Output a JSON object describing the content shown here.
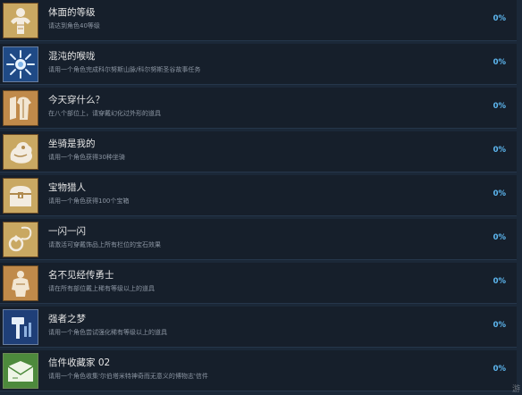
{
  "achievements": [
    {
      "title": "体面的等级",
      "desc": "请达到角色40等级",
      "percent": "0%",
      "icon": "muscle-figure-icon",
      "icon_bg": "#c9a862"
    },
    {
      "title": "混沌的喉咙",
      "desc": "请用一个角色完成科尔努斯山脉/科尔努斯圣谷故事任务",
      "percent": "0%",
      "icon": "chaos-burst-icon",
      "icon_bg": "#1f4a86"
    },
    {
      "title": "今天穿什么？",
      "desc": "在八个部位上，请穿戴幻化过外形的道具",
      "percent": "0%",
      "icon": "wardrobe-icon",
      "icon_bg": "#c08a4a"
    },
    {
      "title": "坐骑是我的",
      "desc": "请用一个角色获得30种坐骑",
      "percent": "0%",
      "icon": "mount-icon",
      "icon_bg": "#c9a862"
    },
    {
      "title": "宝物猎人",
      "desc": "请用一个角色获得100个宝箱",
      "percent": "0%",
      "icon": "treasure-chest-icon",
      "icon_bg": "#c9a862"
    },
    {
      "title": "一闪一闪",
      "desc": "请激活可穿戴饰品上所有栏位的宝石效果",
      "percent": "0%",
      "icon": "gem-ring-icon",
      "icon_bg": "#c9a862"
    },
    {
      "title": "名不见经传勇士",
      "desc": "请在所有部位戴上稀有等级以上的道具",
      "percent": "0%",
      "icon": "warrior-icon",
      "icon_bg": "#c08a4a"
    },
    {
      "title": "强者之梦",
      "desc": "请用一个角色尝试强化稀有等级以上的道具",
      "percent": "0%",
      "icon": "hammer-icon",
      "icon_bg": "#1f3f78"
    },
    {
      "title": "信件收藏家 02",
      "desc": "请用一个角色收集'尔伯塔米特神奇而无意义的博物志'信件",
      "percent": "0%",
      "icon": "letter-icon",
      "icon_bg": "#4d8a3c"
    }
  ],
  "watermark": "游"
}
